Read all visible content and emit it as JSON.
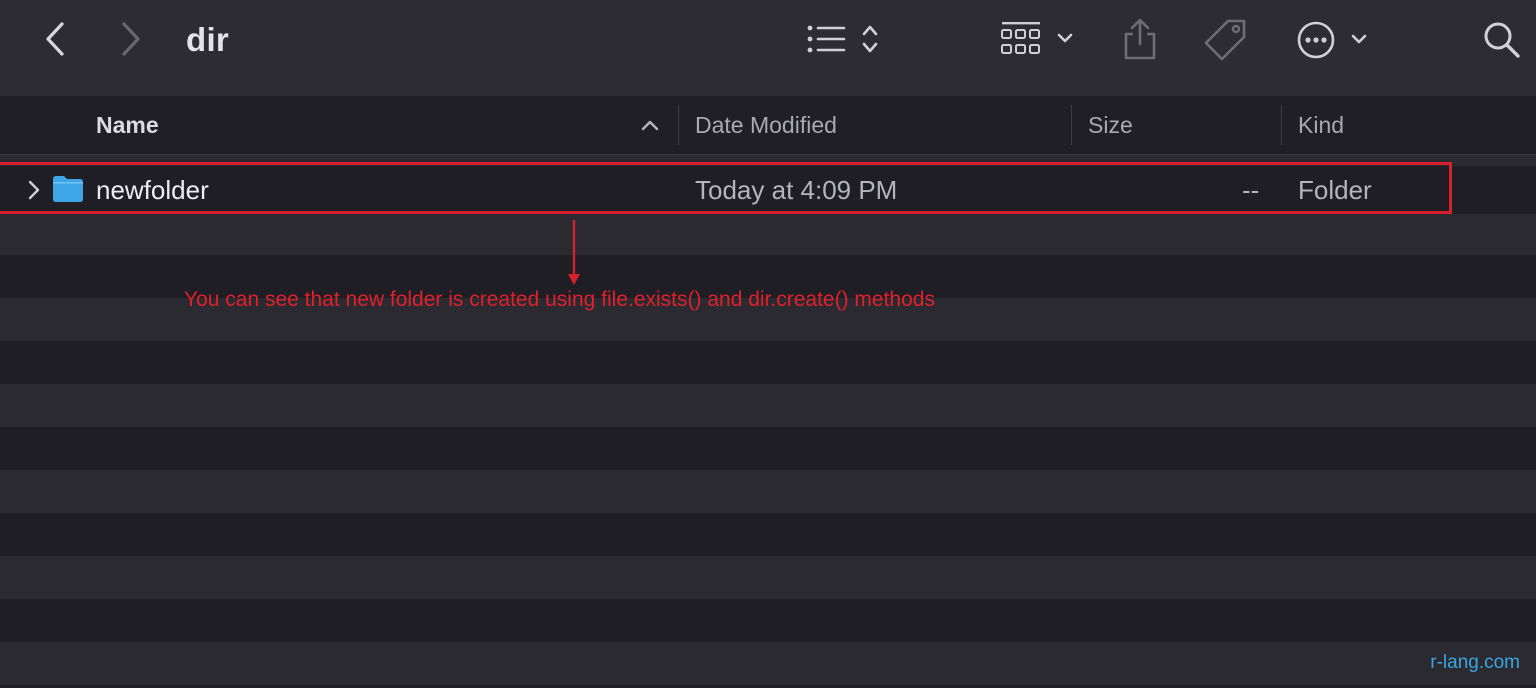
{
  "window": {
    "title": "dir"
  },
  "toolbar": {
    "back_icon": "chevron-left-icon",
    "forward_icon": "chevron-right-icon",
    "view_icon": "list-view-icon",
    "group_icon": "grid-group-icon",
    "share_icon": "share-icon",
    "tag_icon": "tag-icon",
    "more_icon": "ellipsis-circle-icon",
    "search_icon": "search-icon"
  },
  "columns": {
    "name": "Name",
    "date_modified": "Date Modified",
    "size": "Size",
    "kind": "Kind"
  },
  "files": [
    {
      "name": "newfolder",
      "date_modified": "Today at 4:09 PM",
      "size": "--",
      "kind": "Folder",
      "icon": "folder-icon"
    }
  ],
  "annotation": {
    "text": "You can see that new folder is created using file.exists() and dir.create() methods",
    "color": "#e0202a"
  },
  "watermark": "r-lang.com",
  "colors": {
    "background": "#1e1e24",
    "toolbar": "#2d2c32",
    "folder": "#3ea6e6",
    "highlight": "#d6202a",
    "watermark": "#3aa5e0"
  }
}
